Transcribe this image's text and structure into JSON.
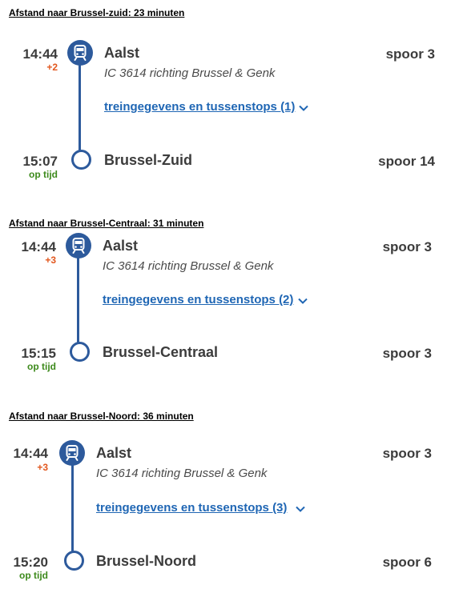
{
  "colors": {
    "line": "#2d5a9c",
    "delay": "#e2571e",
    "on_time": "#3d8a1c",
    "link": "#1f66b4"
  },
  "icons": {
    "train": "train-icon",
    "chevron": "chevron-down-icon",
    "stop": "circle-stop-icon"
  },
  "routes": [
    {
      "header": "Afstand naar Brussel-zuid: 23 minuten",
      "departure": {
        "time": "14:44",
        "delay": "+2",
        "station": "Aalst",
        "platform": "spoor 3"
      },
      "train": "IC 3614 richting Brussel & Genk",
      "details_link": "treingegevens en tussenstops (1)",
      "arrival": {
        "time": "15:07",
        "status": "op tijd",
        "station": "Brussel-Zuid",
        "platform": "spoor 14"
      }
    },
    {
      "header": "Afstand naar Brussel-Centraal: 31 minuten",
      "departure": {
        "time": "14:44",
        "delay": "+3",
        "station": "Aalst",
        "platform": "spoor 3"
      },
      "train": "IC 3614 richting Brussel & Genk",
      "details_link": "treingegevens en tussenstops (2)",
      "arrival": {
        "time": "15:15",
        "status": "op tijd",
        "station": "Brussel-Centraal",
        "platform": "spoor 3"
      }
    },
    {
      "header": "Afstand naar Brussel-Noord: 36 minuten",
      "departure": {
        "time": "14:44",
        "delay": "+3",
        "station": "Aalst",
        "platform": "spoor 3"
      },
      "train": "IC 3614 richting Brussel & Genk",
      "details_link": "treingegevens en tussenstops (3)",
      "arrival": {
        "time": "15:20",
        "status": "op tijd",
        "station": "Brussel-Noord",
        "platform": "spoor 6"
      }
    }
  ]
}
